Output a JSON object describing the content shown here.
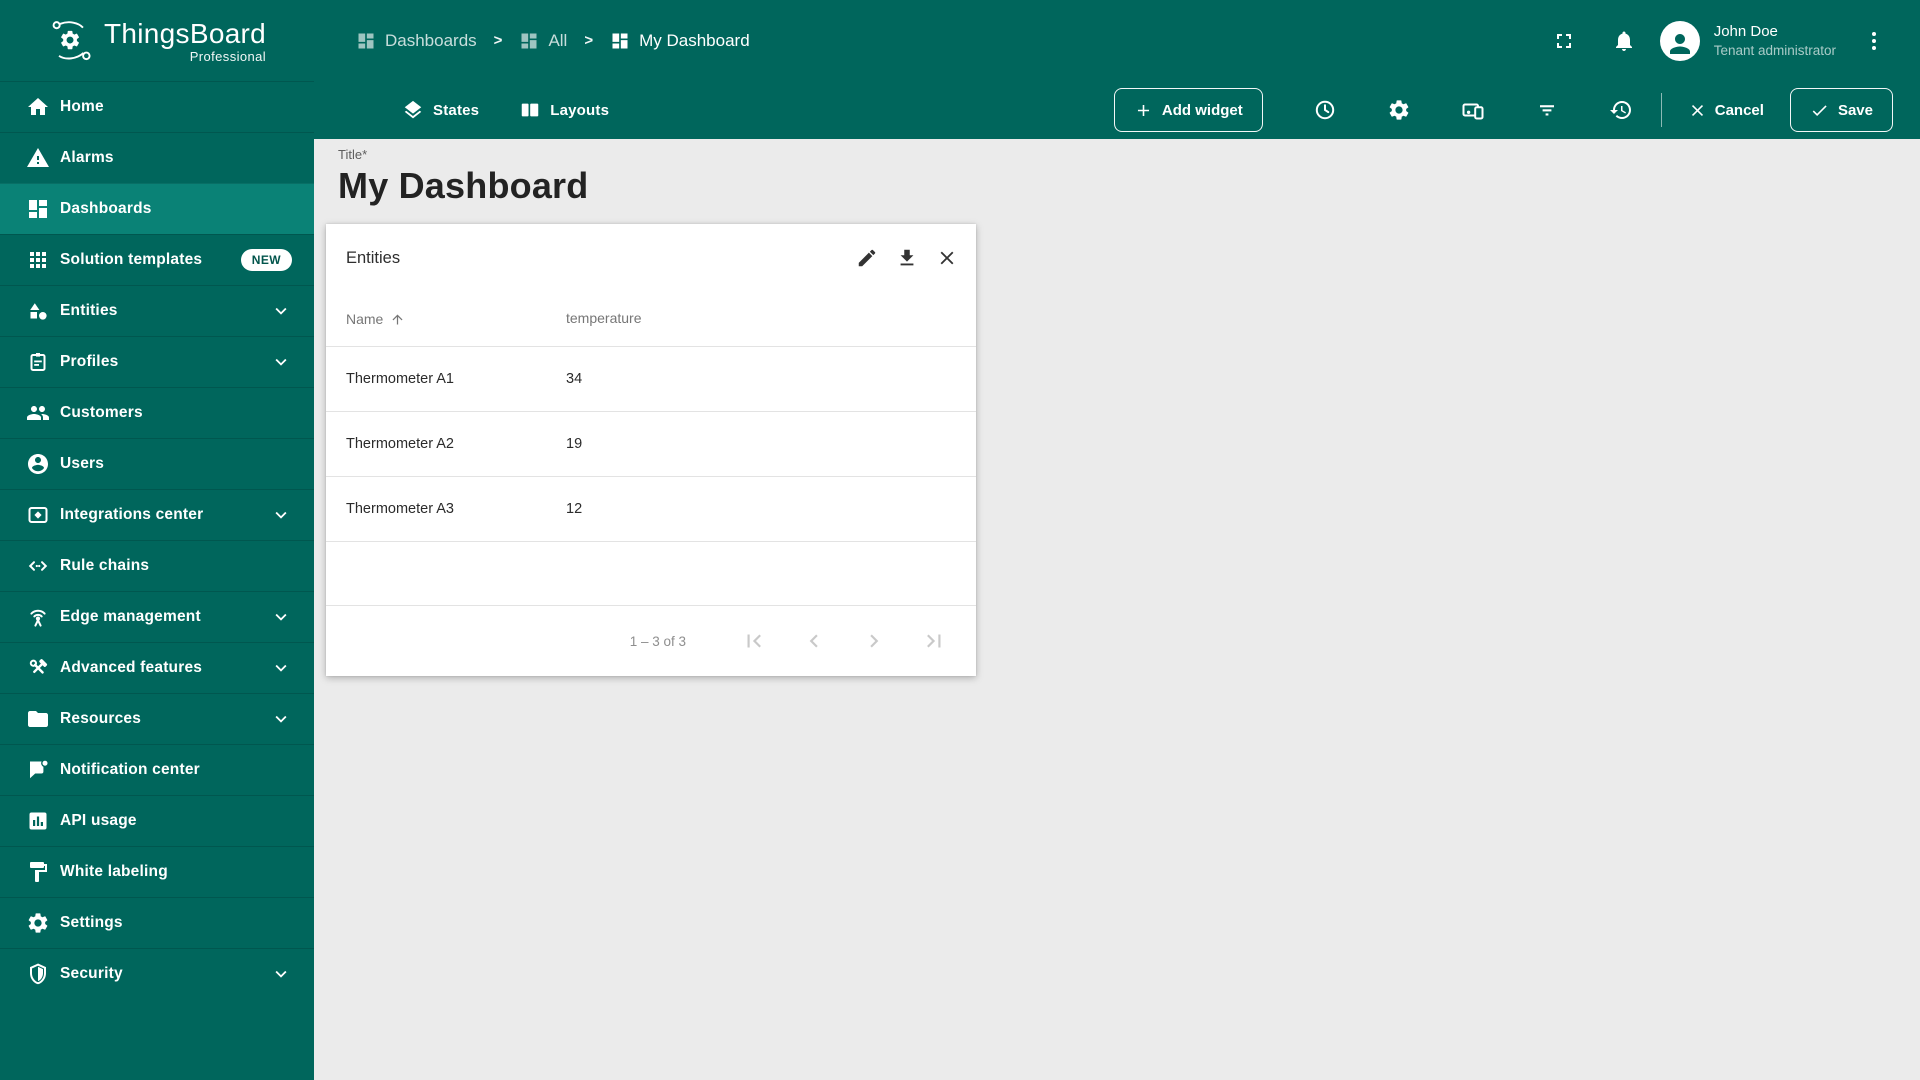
{
  "app": {
    "brand": "ThingsBoard",
    "brand_sub": "Professional"
  },
  "breadcrumb": {
    "separator": ">",
    "items": [
      {
        "label": "Dashboards"
      },
      {
        "label": "All"
      },
      {
        "label": "My Dashboard"
      }
    ]
  },
  "user": {
    "name": "John Doe",
    "role": "Tenant administrator"
  },
  "sidebar": {
    "items": [
      {
        "label": "Home"
      },
      {
        "label": "Alarms"
      },
      {
        "label": "Dashboards",
        "active": true
      },
      {
        "label": "Solution templates",
        "badge": "NEW"
      },
      {
        "label": "Entities",
        "expandable": true
      },
      {
        "label": "Profiles",
        "expandable": true
      },
      {
        "label": "Customers"
      },
      {
        "label": "Users"
      },
      {
        "label": "Integrations center",
        "expandable": true
      },
      {
        "label": "Rule chains"
      },
      {
        "label": "Edge management",
        "expandable": true
      },
      {
        "label": "Advanced features",
        "expandable": true
      },
      {
        "label": "Resources",
        "expandable": true
      },
      {
        "label": "Notification center"
      },
      {
        "label": "API usage"
      },
      {
        "label": "White labeling"
      },
      {
        "label": "Settings"
      },
      {
        "label": "Security",
        "expandable": true
      }
    ]
  },
  "toolbar": {
    "states_label": "States",
    "layouts_label": "Layouts",
    "add_widget_label": "Add widget",
    "cancel_label": "Cancel",
    "save_label": "Save"
  },
  "page": {
    "title_label": "Title*",
    "title": "My Dashboard"
  },
  "widget": {
    "title": "Entities",
    "table": {
      "columns": [
        "Name",
        "temperature"
      ],
      "sort_column": "Name",
      "sort_direction": "asc",
      "rows": [
        {
          "name": "Thermometer A1",
          "temperature": "34"
        },
        {
          "name": "Thermometer A2",
          "temperature": "19"
        },
        {
          "name": "Thermometer A3",
          "temperature": "12"
        }
      ]
    },
    "pagination": {
      "range_label": "1 – 3 of 3"
    }
  },
  "colors": {
    "primary": "#00665c",
    "active_item": "#0a8276",
    "content_bg": "#ebebeb",
    "card_bg": "#ffffff"
  }
}
